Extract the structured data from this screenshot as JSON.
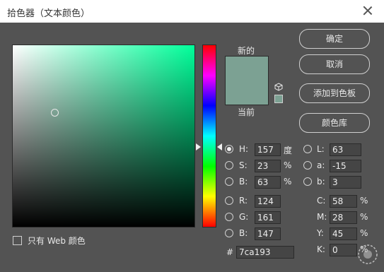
{
  "window": {
    "title": "拾色器（文本颜色）"
  },
  "preview": {
    "new_label": "新的",
    "current_label": "当前",
    "new_color": "#7ca193",
    "current_color": "#7ca193"
  },
  "buttons": {
    "ok": "确定",
    "cancel": "取消",
    "add_swatch": "添加到色板",
    "libraries": "颜色库"
  },
  "hsb": {
    "h": {
      "label": "H:",
      "value": "157",
      "unit": "度"
    },
    "s": {
      "label": "S:",
      "value": "23",
      "unit": "%"
    },
    "b": {
      "label": "B:",
      "value": "63",
      "unit": "%"
    }
  },
  "rgb": {
    "r": {
      "label": "R:",
      "value": "124"
    },
    "g": {
      "label": "G:",
      "value": "161"
    },
    "b": {
      "label": "B:",
      "value": "147"
    }
  },
  "lab": {
    "l": {
      "label": "L:",
      "value": "63"
    },
    "a": {
      "label": "a:",
      "value": "-15"
    },
    "b": {
      "label": "b:",
      "value": "3"
    }
  },
  "cmyk": {
    "c": {
      "label": "C:",
      "value": "58",
      "unit": "%"
    },
    "m": {
      "label": "M:",
      "value": "28",
      "unit": "%"
    },
    "y": {
      "label": "Y:",
      "value": "45",
      "unit": "%"
    },
    "k": {
      "label": "K:",
      "value": "0",
      "unit": "%"
    }
  },
  "hex": {
    "label": "#",
    "value": "7ca193"
  },
  "web_only": {
    "label": "只有 Web 颜色"
  },
  "colors": {
    "field_hue": "#00ff9a",
    "ui_bg": "#535353"
  },
  "selected_radio": "H"
}
